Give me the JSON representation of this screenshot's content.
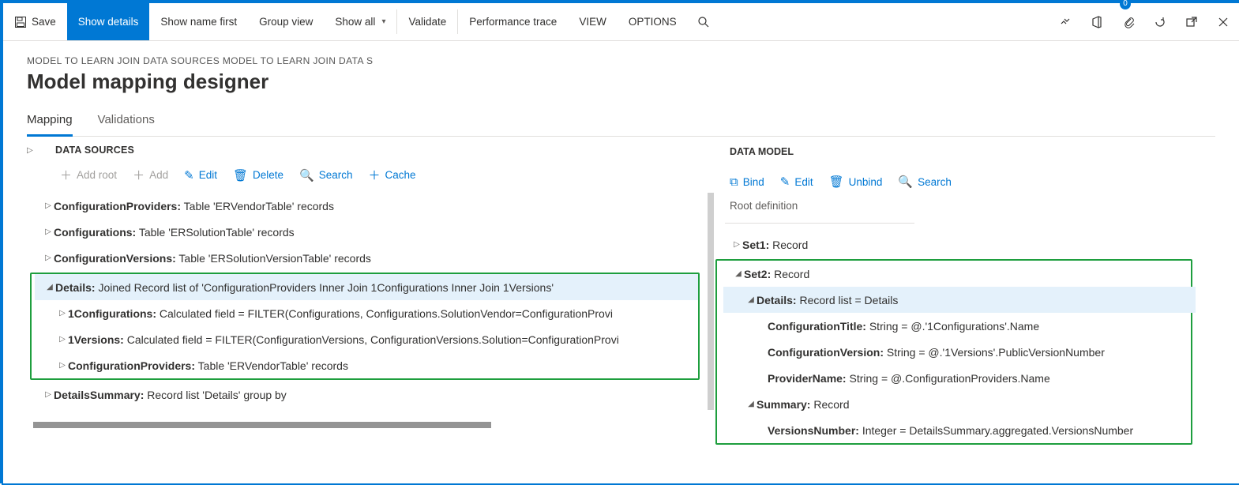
{
  "actionbar": {
    "save": "Save",
    "show_details": "Show details",
    "show_name_first": "Show name first",
    "group_view": "Group view",
    "show_all": "Show all",
    "validate": "Validate",
    "perf_trace": "Performance trace",
    "view": "VIEW",
    "options": "OPTIONS",
    "badge_count": "0"
  },
  "breadcrumb": "MODEL TO LEARN JOIN DATA SOURCES MODEL TO LEARN JOIN DATA S",
  "page_title": "Model mapping designer",
  "tabs": {
    "mapping": "Mapping",
    "validations": "Validations"
  },
  "ds": {
    "title": "DATA SOURCES",
    "add_root": "Add root",
    "add": "Add",
    "edit": "Edit",
    "delete": "Delete",
    "search": "Search",
    "cache": "Cache",
    "rows": [
      {
        "name": "ConfigurationProviders:",
        "rest": " Table 'ERVendorTable' records"
      },
      {
        "name": "Configurations:",
        "rest": " Table 'ERSolutionTable' records"
      },
      {
        "name": "ConfigurationVersions:",
        "rest": " Table 'ERSolutionVersionTable' records"
      },
      {
        "name": "Details:",
        "rest": " Joined Record list of 'ConfigurationProviders Inner Join 1Configurations Inner Join 1Versions'"
      },
      {
        "name": "1Configurations:",
        "rest": " Calculated field = FILTER(Configurations, Configurations.SolutionVendor=ConfigurationProvi"
      },
      {
        "name": "1Versions:",
        "rest": " Calculated field = FILTER(ConfigurationVersions, ConfigurationVersions.Solution=ConfigurationProvi"
      },
      {
        "name": "ConfigurationProviders:",
        "rest": " Table 'ERVendorTable' records"
      },
      {
        "name": "DetailsSummary:",
        "rest": " Record list 'Details' group by"
      }
    ]
  },
  "dm": {
    "title": "DATA MODEL",
    "bind": "Bind",
    "edit": "Edit",
    "unbind": "Unbind",
    "search": "Search",
    "root_def": "Root definition",
    "rows": {
      "set1": {
        "name": "Set1:",
        "rest": " Record"
      },
      "set2": {
        "name": "Set2:",
        "rest": " Record"
      },
      "details": {
        "name": "Details:",
        "rest": " Record list = Details"
      },
      "conf_title": {
        "name": "ConfigurationTitle:",
        "rest": " String = @.'1Configurations'.Name"
      },
      "conf_ver": {
        "name": "ConfigurationVersion:",
        "rest": " String = @.'1Versions'.PublicVersionNumber"
      },
      "prov": {
        "name": "ProviderName:",
        "rest": " String = @.ConfigurationProviders.Name"
      },
      "summary": {
        "name": "Summary:",
        "rest": " Record"
      },
      "vernum": {
        "name": "VersionsNumber:",
        "rest": " Integer = DetailsSummary.aggregated.VersionsNumber"
      }
    }
  }
}
